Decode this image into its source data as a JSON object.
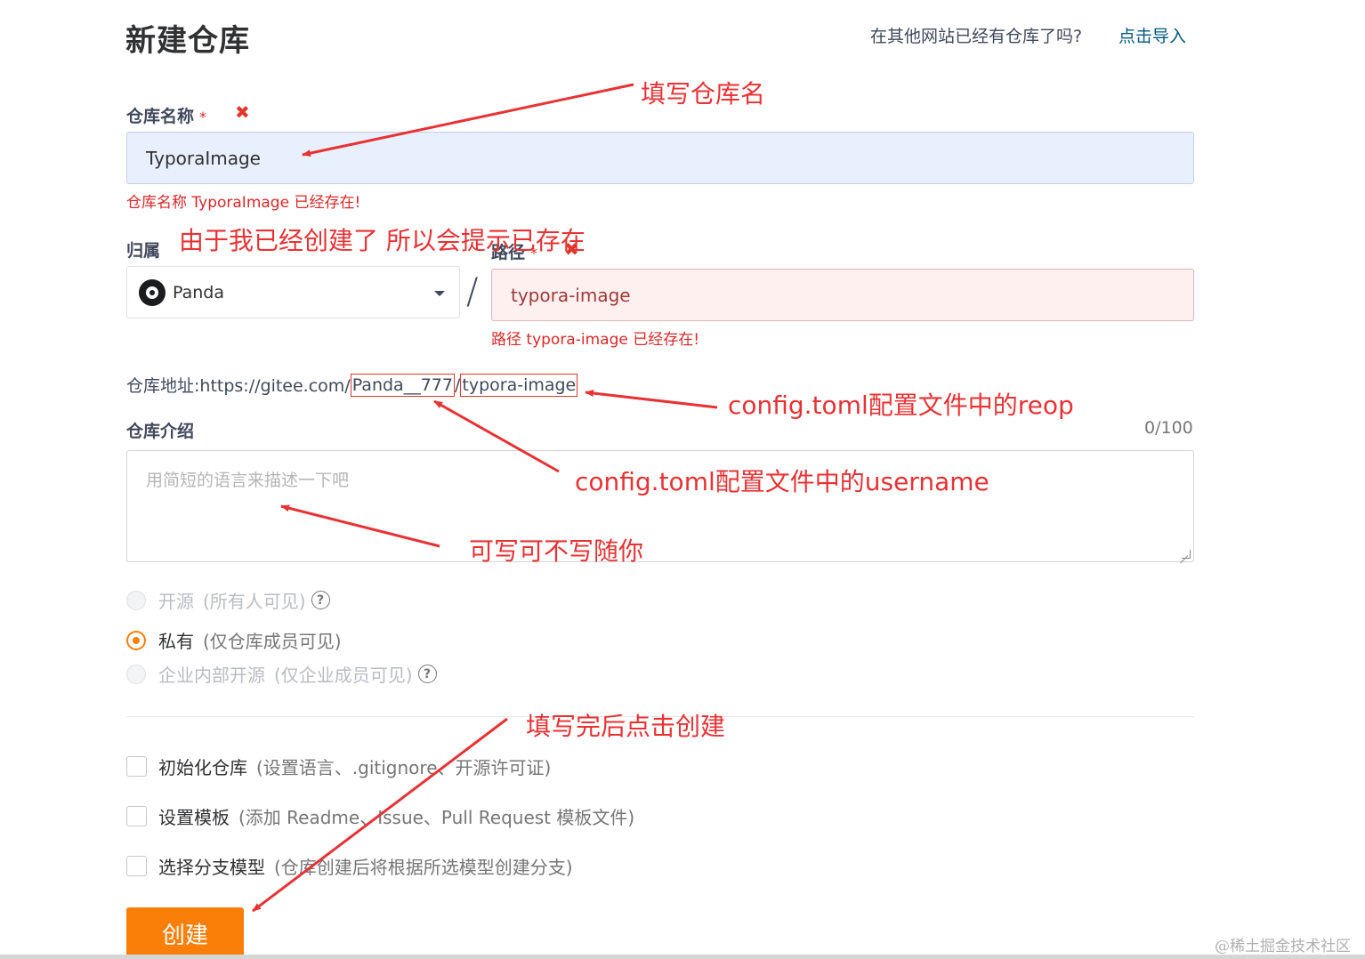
{
  "page": {
    "title": "新建仓库"
  },
  "import_prompt": {
    "text": "在其他网站已经有仓库了吗?",
    "link": "点击导入"
  },
  "repo_name": {
    "label": "仓库名称",
    "required_marker": "*",
    "error_icon": "close-icon",
    "value": "TyporaImage",
    "error": "仓库名称 TyporaImage 已经存在!"
  },
  "owner": {
    "label": "归属",
    "value": "Panda",
    "avatar": "avatar-icon"
  },
  "separator": "/",
  "path": {
    "label": "路径",
    "required_marker": "*",
    "error_icon": "close-icon",
    "value": "typora-image",
    "error": "路径 typora-image 已经存在!"
  },
  "address": {
    "prefix": "仓库地址:https://gitee.com/",
    "username": "Panda__777",
    "sep": "/",
    "repo": "typora-image"
  },
  "description": {
    "label": "仓库介绍",
    "counter": "0/100",
    "placeholder": "用简短的语言来描述一下吧"
  },
  "visibility": [
    {
      "label": "开源",
      "sub": "(所有人可见)",
      "checked": false,
      "disabled": true,
      "help": "?"
    },
    {
      "label": "私有",
      "sub": "(仅仓库成员可见)",
      "checked": true,
      "disabled": false
    },
    {
      "label": "企业内部开源",
      "sub": "(仅企业成员可见)",
      "checked": false,
      "disabled": true,
      "help": "?"
    }
  ],
  "options": [
    {
      "label": "初始化仓库",
      "sub": "(设置语言、.gitignore、开源许可证)",
      "checked": false
    },
    {
      "label": "设置模板",
      "sub": "(添加 Readme、Issue、Pull Request 模板文件)",
      "checked": false
    },
    {
      "label": "选择分支模型",
      "sub": "(仓库创建后将根据所选模型创建分支)",
      "checked": false
    }
  ],
  "submit": {
    "label": "创建"
  },
  "annotations": {
    "name": "填写仓库名",
    "exists": "由于我已经创建了 所以会提示已存在",
    "repo": "config.toml配置文件中的reop",
    "username": "config.toml配置文件中的username",
    "optional": "可写可不写随你",
    "submit": "填写完后点击创建"
  },
  "watermark": "@稀土掘金技术社区",
  "colors": {
    "accent": "#fa7f08",
    "error": "#db2828",
    "annotation": "#e83234",
    "link": "#005980"
  }
}
